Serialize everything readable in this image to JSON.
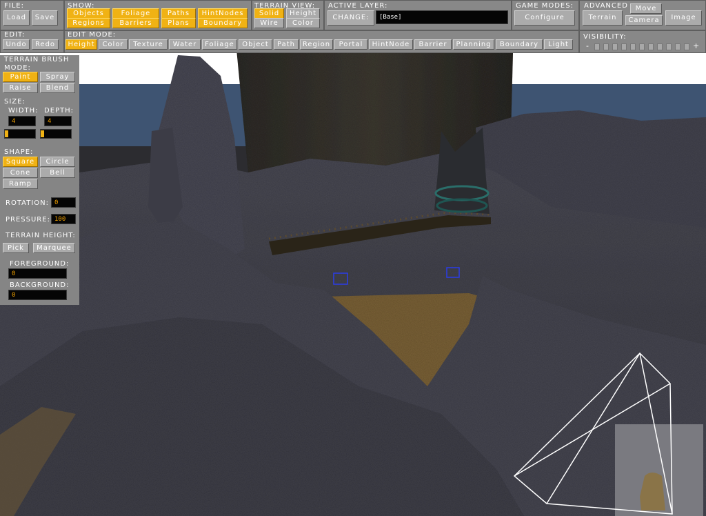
{
  "file": {
    "label": "FILE:",
    "load": "Load",
    "save": "Save"
  },
  "show": {
    "label": "SHOW:",
    "objects": "Objects",
    "foliage": "Foliage",
    "paths": "Paths",
    "hintnodes": "HintNodes",
    "regions": "Regions",
    "barriers": "Barriers",
    "plans": "Plans",
    "boundary": "Boundary"
  },
  "terrain_view": {
    "label": "TERRAIN VIEW:",
    "solid": "Solid",
    "height": "Height",
    "wire": "Wire",
    "color": "Color"
  },
  "active_layer": {
    "label": "ACTIVE LAYER:",
    "change": "CHANGE:",
    "value": "[Base]"
  },
  "game_modes": {
    "label": "GAME MODES:",
    "configure": "Configure"
  },
  "advanced": {
    "label": "ADVANCED",
    "terrain": "Terrain",
    "move": "Move",
    "camera": "Camera",
    "image": "Image"
  },
  "edit": {
    "label": "EDIT:",
    "undo": "Undo",
    "redo": "Redo"
  },
  "edit_mode": {
    "label": "EDIT MODE:",
    "modes": [
      "Height",
      "Color",
      "Texture",
      "Water",
      "Foliage",
      "Object",
      "Path",
      "Region",
      "Portal",
      "HintNode",
      "Barrier",
      "Planning",
      "Boundary",
      "Light"
    ],
    "active": "Height"
  },
  "visibility": {
    "label": "VISIBILITY:",
    "minus": "-",
    "plus": "+",
    "level": 0
  },
  "brush": {
    "title": "TERRAIN BRUSH",
    "mode_label": "MODE:",
    "paint": "Paint",
    "spray": "Spray",
    "raise": "Raise",
    "blend": "Blend",
    "size_label": "SIZE:",
    "width_label": "WIDTH:",
    "depth_label": "DEPTH:",
    "width_value": "4",
    "depth_value": "4",
    "shape_label": "SHAPE:",
    "square": "Square",
    "circle": "Circle",
    "cone": "Cone",
    "bell": "Bell",
    "ramp": "Ramp",
    "rotation_label": "ROTATION:",
    "rotation_value": "0",
    "pressure_label": "PRESSURE:",
    "pressure_value": "100",
    "terrain_height_label": "TERRAIN HEIGHT:",
    "pick": "Pick",
    "marquee": "Marquee",
    "foreground_label": "FOREGROUND:",
    "foreground_value": "0",
    "background_label": "BACKGROUND:",
    "background_value": "0"
  },
  "colors": {
    "accent": "#f0b214",
    "panel": "#888888",
    "button": "#ababab",
    "field_bg": "#050505",
    "field_text": "#f0a000",
    "sky": "#3e5472",
    "rock": "#3b3b44",
    "sand": "#7a6238"
  }
}
